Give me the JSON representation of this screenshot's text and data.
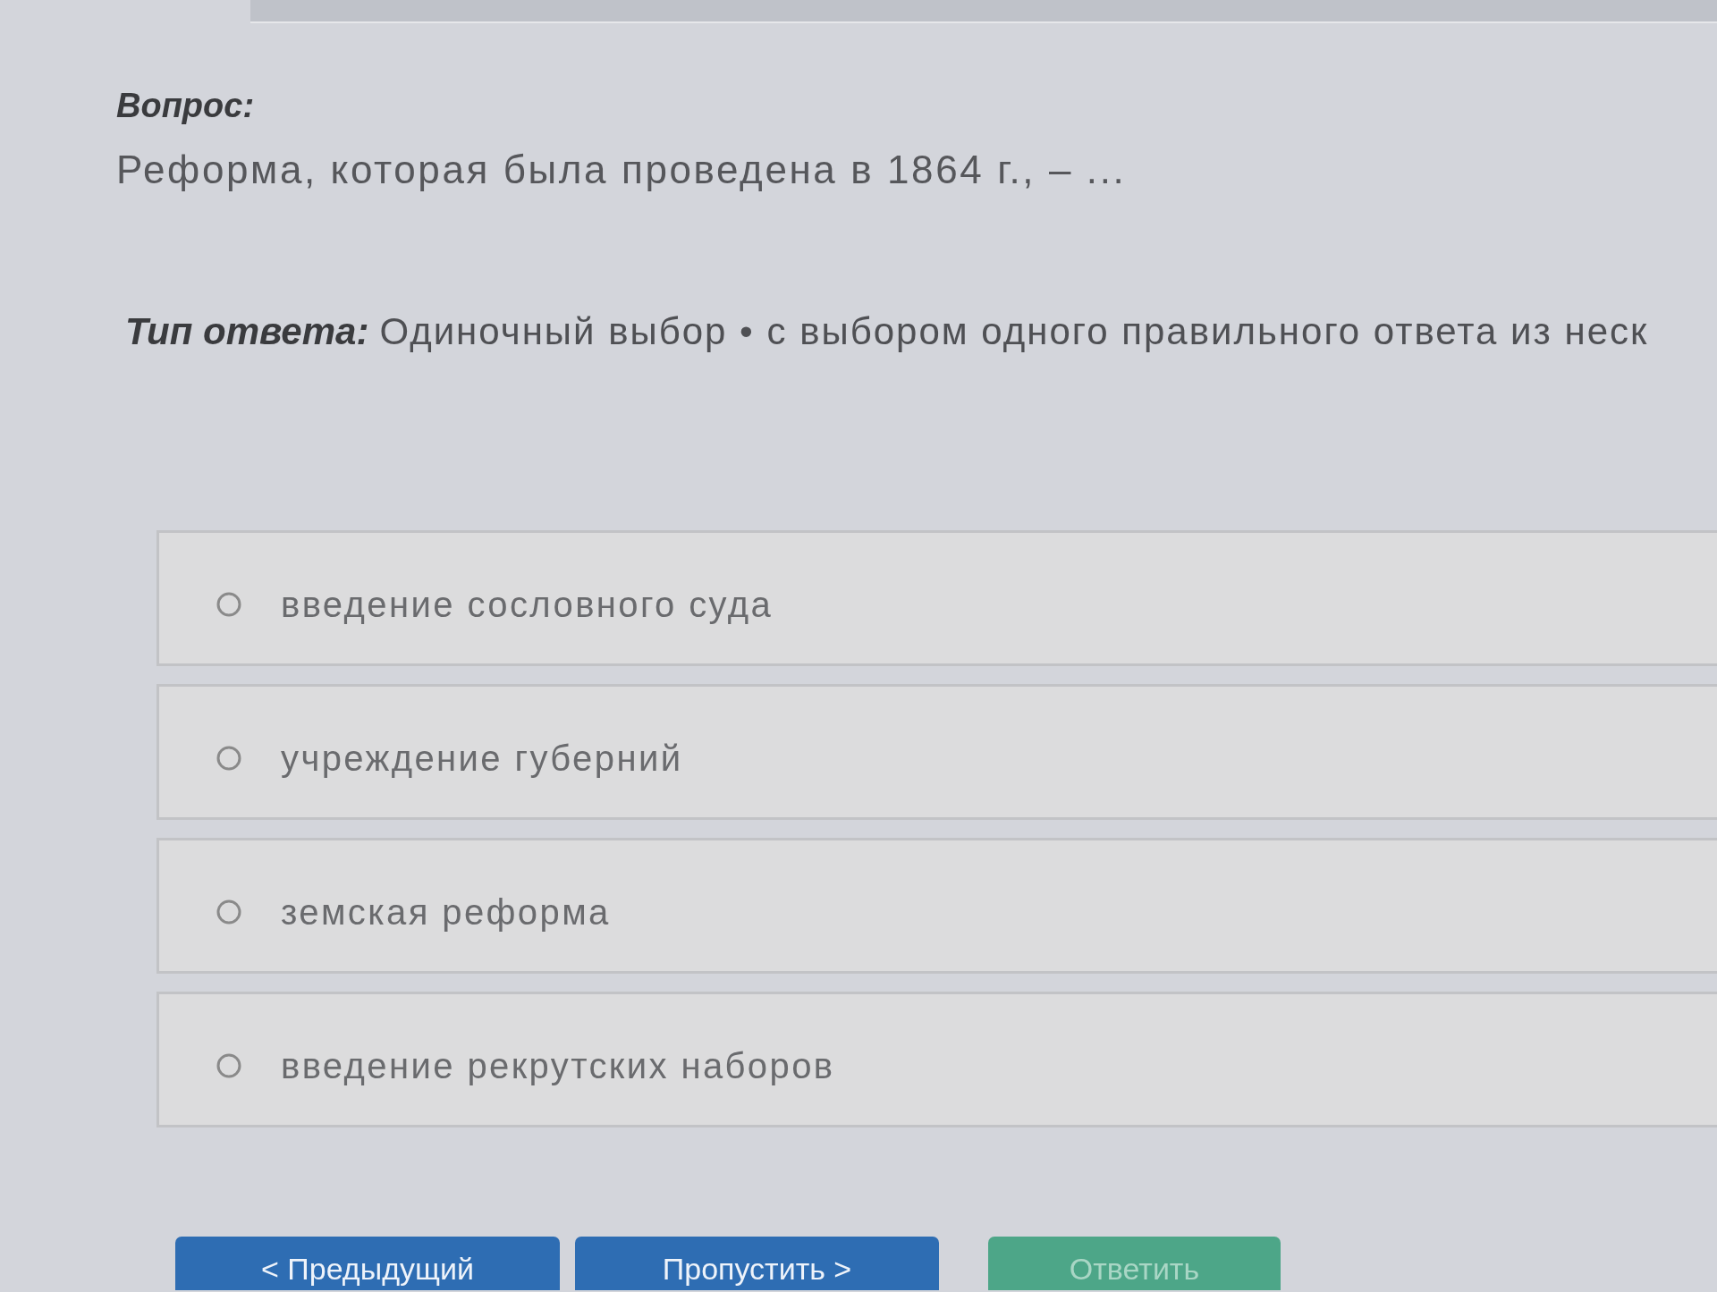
{
  "question": {
    "label": "Вопрос:",
    "text": "Реформа, которая была проведена в 1864 г., – ..."
  },
  "answer_type": {
    "label": "Тип ответа:",
    "value": "Одиночный выбор • с выбором одного правильного ответа из неск"
  },
  "options": [
    {
      "text": "введение сословного суда",
      "selected": false
    },
    {
      "text": "учреждение губерний",
      "selected": false
    },
    {
      "text": "земская реформа",
      "selected": false
    },
    {
      "text": "введение рекрутских наборов",
      "selected": false
    }
  ],
  "buttons": [
    {
      "label": "< Предыдущий",
      "kind": "primary",
      "disabled": false
    },
    {
      "label": "Пропустить >",
      "kind": "primary",
      "disabled": false
    },
    {
      "label": "Ответить",
      "kind": "success",
      "disabled": true
    }
  ]
}
